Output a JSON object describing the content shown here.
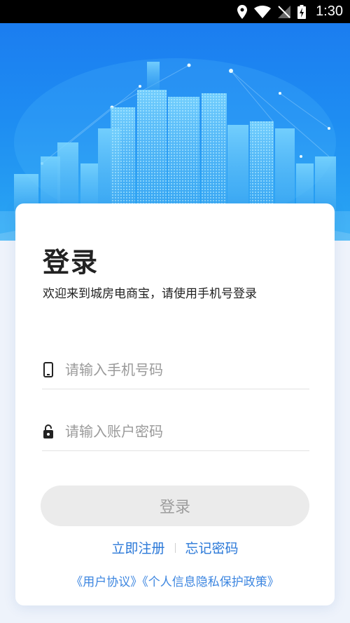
{
  "status_bar": {
    "time": "1:30",
    "icons": [
      "location-icon",
      "wifi-icon",
      "no-signal-icon",
      "battery-charging-icon"
    ]
  },
  "login": {
    "title": "登录",
    "subtitle": "欢迎来到城房电商宝，请使用手机号登录",
    "phone_placeholder": "请输入手机号码",
    "password_placeholder": "请输入账户密码",
    "submit_label": "登录",
    "register_label": "立即注册",
    "forgot_label": "忘记密码",
    "user_agreement_label": "《用户协议》",
    "privacy_policy_label": "《个人信息隐私保护政策》"
  },
  "colors": {
    "primary": "#1e88f0",
    "link": "#2a78d8",
    "button_disabled_bg": "#ebebeb",
    "button_disabled_text": "#9d9d9d"
  }
}
